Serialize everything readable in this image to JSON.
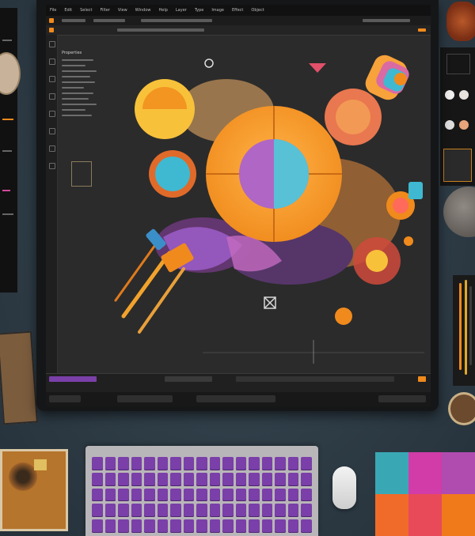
{
  "app": {
    "menu_items": [
      "File",
      "Edit",
      "Select",
      "Filter",
      "View",
      "Window",
      "Help",
      "Layer",
      "Type",
      "Image",
      "Effect",
      "Object",
      "Color",
      "Tools"
    ],
    "panel_title": "Properties"
  },
  "canvas": {
    "close_glyph": "☒",
    "marker_glyph": "⊘"
  },
  "colors": {
    "accent": "#f08a1c",
    "orange": "#f7a23a",
    "deep_orange": "#e66a1f",
    "yellow": "#f8c13a",
    "cyan": "#3fb9d1",
    "purple": "#9a5bc4",
    "pink": "#d96aa4",
    "panel_bg": "#2b2b2b",
    "desk": "#2c3a44",
    "key_purple": "#7a3fa8"
  },
  "icons": {
    "close": "close-icon",
    "marker": "circle-marker-icon"
  }
}
